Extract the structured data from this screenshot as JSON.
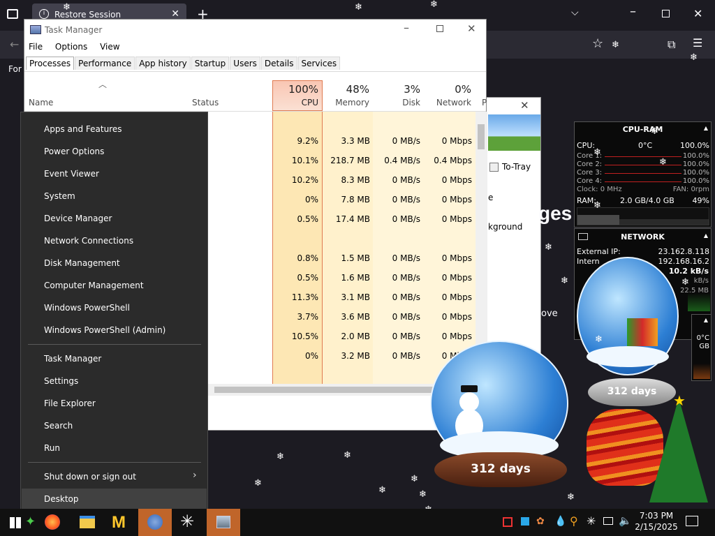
{
  "browser": {
    "tab_title": "Restore Session",
    "partial_text": "For"
  },
  "taskmanager": {
    "title": "Task Manager",
    "menu": [
      "File",
      "Options",
      "View"
    ],
    "tabs": [
      "Processes",
      "Performance",
      "App history",
      "Startup",
      "Users",
      "Details",
      "Services"
    ],
    "cols": {
      "name": "Name",
      "status": "Status",
      "cpu_pct": "100%",
      "cpu": "CPU",
      "mem_pct": "48%",
      "mem": "Memory",
      "disk_pct": "3%",
      "disk": "Disk",
      "net_pct": "0%",
      "net": "Network",
      "extra": "P"
    },
    "rows": [
      {
        "cpu": "",
        "mem": "",
        "disk": "",
        "net": ""
      },
      {
        "cpu": "9.2%",
        "mem": "3.3 MB",
        "disk": "0 MB/s",
        "net": "0 Mbps"
      },
      {
        "cpu": "10.1%",
        "mem": "218.7 MB",
        "disk": "0.4 MB/s",
        "net": "0.4 Mbps"
      },
      {
        "cpu": "10.2%",
        "mem": "8.3 MB",
        "disk": "0 MB/s",
        "net": "0 Mbps"
      },
      {
        "cpu": "0%",
        "mem": "7.8 MB",
        "disk": "0 MB/s",
        "net": "0 Mbps"
      },
      {
        "cpu": "0.5%",
        "mem": "17.4 MB",
        "disk": "0 MB/s",
        "net": "0 Mbps"
      },
      {
        "cpu": "",
        "mem": "",
        "disk": "",
        "net": ""
      },
      {
        "cpu": "0.8%",
        "mem": "1.5 MB",
        "disk": "0 MB/s",
        "net": "0 Mbps"
      },
      {
        "cpu": "0.5%",
        "mem": "1.6 MB",
        "disk": "0 MB/s",
        "net": "0 Mbps"
      },
      {
        "cpu": "11.3%",
        "mem": "3.1 MB",
        "disk": "0 MB/s",
        "net": "0 Mbps"
      },
      {
        "cpu": "3.7%",
        "mem": "3.6 MB",
        "disk": "0 MB/s",
        "net": "0 Mbps"
      },
      {
        "cpu": "10.5%",
        "mem": "2.0 MB",
        "disk": "0 MB/s",
        "net": "0 Mbps"
      },
      {
        "cpu": "0%",
        "mem": "3.2 MB",
        "disk": "0 MB/s",
        "net": "0 Mbps"
      }
    ]
  },
  "behind_window": {
    "totray": "To-Tray",
    "frag_e": "e",
    "frag_background": "kground",
    "frag_ges": "ges",
    "frag_ove": "ove"
  },
  "context_menu": {
    "group1": [
      "Apps and Features",
      "Power Options",
      "Event Viewer",
      "System",
      "Device Manager",
      "Network Connections",
      "Disk Management",
      "Computer Management",
      "Windows PowerShell",
      "Windows PowerShell (Admin)"
    ],
    "group2": [
      "Task Manager",
      "Settings",
      "File Explorer",
      "Search",
      "Run"
    ],
    "shutdown": "Shut down or sign out",
    "desktop": "Desktop"
  },
  "cpu_gadget": {
    "title": "CPU-RAM",
    "cpu_label": "CPU:",
    "temp": "0°C",
    "cpu_value": "100.0%",
    "cores": [
      {
        "label": "Core 1:",
        "value": "100.0%"
      },
      {
        "label": "Core 2:",
        "value": "100.0%"
      },
      {
        "label": "Core 3:",
        "value": "100.0%"
      },
      {
        "label": "Core 4:",
        "value": "100.0%"
      }
    ],
    "clock": "Clock: 0 MHz",
    "fan": "FAN: 0rpm",
    "ram_label": "RAM:",
    "ram_value": "2.0 GB/4.0 GB",
    "ram_pct": "49%"
  },
  "net_gadget": {
    "title": "NETWORK",
    "external_label": "External IP:",
    "external_ip": "23.162.8.118",
    "internal_label": "Intern",
    "internal_ip": "192.168.16.2",
    "rate1": "10.2 kB/s",
    "rate2": "kB/s",
    "total": "22.5 MB",
    "side_temp": "0°C",
    "side_gb": "GB"
  },
  "globes": {
    "left_days": "312 days",
    "right_days": "312 days"
  },
  "tray": {
    "time": "7:03 PM",
    "date": "2/15/2025"
  }
}
